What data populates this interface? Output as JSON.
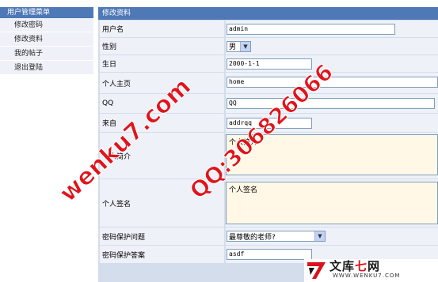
{
  "sidebar": {
    "title": "用户管理菜单",
    "items": [
      {
        "label": "修改密码"
      },
      {
        "label": "修改资料"
      },
      {
        "label": "我的帖子"
      },
      {
        "label": "退出登陆"
      }
    ]
  },
  "form": {
    "title": "修改资料",
    "username": {
      "label": "用户名",
      "value": "admin"
    },
    "gender": {
      "label": "性别",
      "value": "男"
    },
    "birthday": {
      "label": "生日",
      "value": "2000-1-1"
    },
    "homepage": {
      "label": "个人主页",
      "value": "home"
    },
    "qq": {
      "label": "QQ",
      "value": "QQ"
    },
    "from": {
      "label": "来自",
      "value": "addrqq"
    },
    "intro": {
      "label": "个人简介",
      "value": "个人简介"
    },
    "signature": {
      "label": "个人签名",
      "value": "个人签名"
    },
    "security_question": {
      "label": "密码保护问题",
      "value": "最尊敬的老师?"
    },
    "security_answer": {
      "label": "密码保护答案",
      "value": "asdf"
    }
  },
  "watermarks": {
    "site": "wenku7.com",
    "qq": "QQ:306826066"
  },
  "logo": {
    "text_black": "文库",
    "text_red": "七",
    "text_black2": "网",
    "url": "WWW.WENKU7.COM"
  },
  "colors": {
    "header_blue": "#4f79b6",
    "row_bg": "#eef1f8",
    "panel_bg": "#d4ddec",
    "textarea_bg": "#fff8e6",
    "watermark_red": "#e0141b"
  }
}
